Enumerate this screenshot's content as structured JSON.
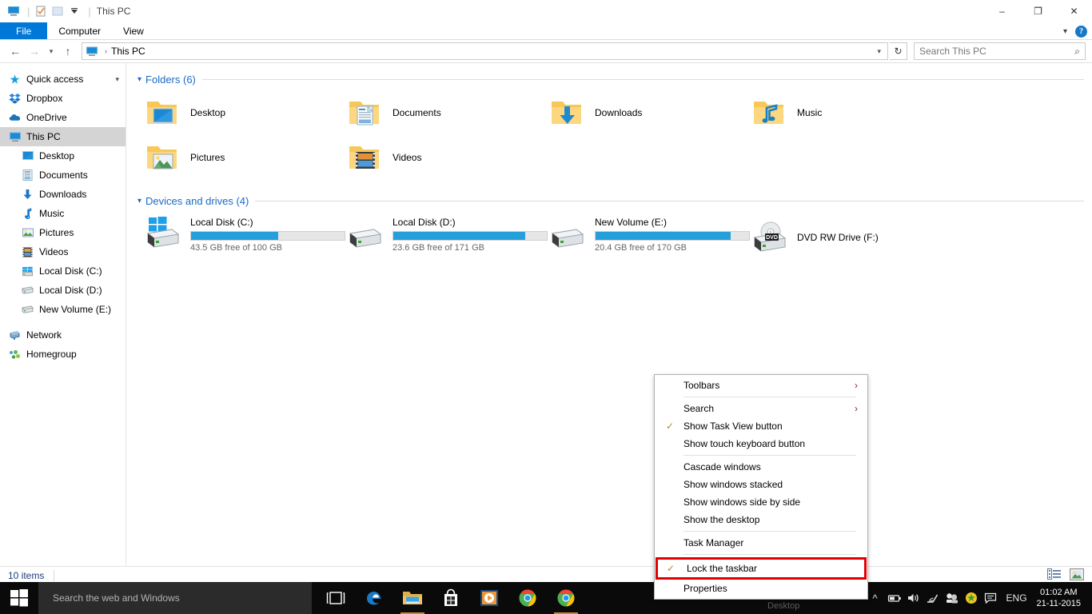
{
  "window": {
    "title": "This PC",
    "quick_access_icons": [
      "pc-icon",
      "properties-icon",
      "new-folder-icon",
      "customize-dropdown-icon"
    ],
    "controls": {
      "minimize": "–",
      "restore": "❐",
      "close": "✕"
    }
  },
  "ribbon": {
    "tabs": [
      {
        "label": "File",
        "active": true
      },
      {
        "label": "Computer",
        "active": false
      },
      {
        "label": "View",
        "active": false
      }
    ],
    "collapse_icon": "chevron-down-icon",
    "help_label": "?"
  },
  "address": {
    "back_icon": "←",
    "forward_icon": "→",
    "recent_icon": "⌄",
    "up_icon": "↑",
    "breadcrumb_icon": "pc-icon",
    "breadcrumb": "This PC",
    "separator": "›",
    "dropdown_icon": "⌄",
    "refresh_icon": "↻"
  },
  "search": {
    "placeholder": "Search This PC",
    "icon": "search-icon"
  },
  "sidebar": {
    "items": [
      {
        "label": "Quick access",
        "icon": "star-pin-icon",
        "level": 0,
        "selected": false,
        "chevron": true
      },
      {
        "label": "Dropbox",
        "icon": "dropbox-icon",
        "level": 0,
        "selected": false,
        "chevron": false
      },
      {
        "label": "OneDrive",
        "icon": "onedrive-cloud-icon",
        "level": 0,
        "selected": false,
        "chevron": false
      },
      {
        "label": "This PC",
        "icon": "pc-icon",
        "level": 0,
        "selected": true,
        "chevron": false
      },
      {
        "label": "Desktop",
        "icon": "desktop-icon",
        "level": 1,
        "selected": false,
        "chevron": false
      },
      {
        "label": "Documents",
        "icon": "documents-icon",
        "level": 1,
        "selected": false,
        "chevron": false
      },
      {
        "label": "Downloads",
        "icon": "downloads-arrow-icon",
        "level": 1,
        "selected": false,
        "chevron": false
      },
      {
        "label": "Music",
        "icon": "music-note-icon",
        "level": 1,
        "selected": false,
        "chevron": false
      },
      {
        "label": "Pictures",
        "icon": "pictures-icon",
        "level": 1,
        "selected": false,
        "chevron": false
      },
      {
        "label": "Videos",
        "icon": "videos-film-icon",
        "level": 1,
        "selected": false,
        "chevron": false
      },
      {
        "label": "Local Disk (C:)",
        "icon": "windows-drive-icon",
        "level": 1,
        "selected": false,
        "chevron": false
      },
      {
        "label": "Local Disk (D:)",
        "icon": "drive-icon",
        "level": 1,
        "selected": false,
        "chevron": false
      },
      {
        "label": "New Volume (E:)",
        "icon": "drive-icon",
        "level": 1,
        "selected": false,
        "chevron": false
      },
      {
        "label": "Network",
        "icon": "network-icon",
        "level": 0,
        "selected": false,
        "chevron": false
      },
      {
        "label": "Homegroup",
        "icon": "homegroup-icon",
        "level": 0,
        "selected": false,
        "chevron": false
      }
    ]
  },
  "main": {
    "folders_group": {
      "title": "Folders (6)",
      "chevron": "⌄",
      "items": [
        {
          "label": "Desktop",
          "icon": "folder-desktop-icon"
        },
        {
          "label": "Documents",
          "icon": "folder-documents-icon"
        },
        {
          "label": "Downloads",
          "icon": "folder-downloads-icon"
        },
        {
          "label": "Music",
          "icon": "folder-music-icon"
        },
        {
          "label": "Pictures",
          "icon": "folder-pictures-icon"
        },
        {
          "label": "Videos",
          "icon": "folder-videos-icon"
        }
      ]
    },
    "drives_group": {
      "title": "Devices and drives (4)",
      "chevron": "⌄",
      "items": [
        {
          "label": "Local Disk (C:)",
          "icon": "windows-drive-icon",
          "free_text": "43.5 GB free of 100 GB",
          "used_percent": 57,
          "has_bar": true
        },
        {
          "label": "Local Disk (D:)",
          "icon": "drive-icon",
          "free_text": "23.6 GB free of 171 GB",
          "used_percent": 86,
          "has_bar": true
        },
        {
          "label": "New Volume (E:)",
          "icon": "drive-icon",
          "free_text": "20.4 GB free of 170 GB",
          "used_percent": 88,
          "has_bar": true
        },
        {
          "label": "DVD RW Drive (F:)",
          "icon": "dvd-drive-icon",
          "free_text": "",
          "used_percent": 0,
          "has_bar": false
        }
      ]
    }
  },
  "status": {
    "item_count": "10 items",
    "view_details_icon": "details-view-icon",
    "view_large_icon": "large-icons-view-icon"
  },
  "context_menu": {
    "items": [
      {
        "label": "Toolbars",
        "checked": false,
        "submenu": true,
        "highlighted": false,
        "sep_after": true
      },
      {
        "label": "Search",
        "checked": false,
        "submenu": true,
        "highlighted": false,
        "sep_after": false
      },
      {
        "label": "Show Task View button",
        "checked": true,
        "submenu": false,
        "highlighted": false,
        "sep_after": false
      },
      {
        "label": "Show touch keyboard button",
        "checked": false,
        "submenu": false,
        "highlighted": false,
        "sep_after": true
      },
      {
        "label": "Cascade windows",
        "checked": false,
        "submenu": false,
        "highlighted": false,
        "sep_after": false
      },
      {
        "label": "Show windows stacked",
        "checked": false,
        "submenu": false,
        "highlighted": false,
        "sep_after": false
      },
      {
        "label": "Show windows side by side",
        "checked": false,
        "submenu": false,
        "highlighted": false,
        "sep_after": false
      },
      {
        "label": "Show the desktop",
        "checked": false,
        "submenu": false,
        "highlighted": false,
        "sep_after": true
      },
      {
        "label": "Task Manager",
        "checked": false,
        "submenu": false,
        "highlighted": false,
        "sep_after": true
      },
      {
        "label": "Lock the taskbar",
        "checked": true,
        "submenu": false,
        "highlighted": true,
        "sep_after": false
      },
      {
        "label": "Properties",
        "checked": false,
        "submenu": false,
        "highlighted": false,
        "sep_after": false
      }
    ],
    "highlight_color": "#e00000",
    "check_glyph": "✓",
    "arrow_glyph": "›"
  },
  "taskbar": {
    "start_icon": "windows-start-icon",
    "search_placeholder": "Search the web and Windows",
    "desktop_peek_label": "Desktop",
    "pinned": [
      {
        "name": "task-view-icon",
        "open": false
      },
      {
        "name": "edge-icon",
        "open": false
      },
      {
        "name": "file-explorer-icon",
        "open": true
      },
      {
        "name": "store-icon",
        "open": false
      },
      {
        "name": "media-player-icon",
        "open": false
      },
      {
        "name": "chrome-icon",
        "open": false
      },
      {
        "name": "chrome-canary-icon",
        "open": true
      }
    ],
    "tray": {
      "overflow_icon": "⌃",
      "battery_icon": "battery-icon",
      "volume_icon": "volume-icon",
      "wifi_icon": "wifi-icon",
      "network-dual_icon": "network-dual-icon",
      "shield_icon": "shield-icon",
      "notification_icon": "notification-icon",
      "language": "ENG",
      "time": "01:02 AM",
      "date": "21-11-2015"
    }
  }
}
